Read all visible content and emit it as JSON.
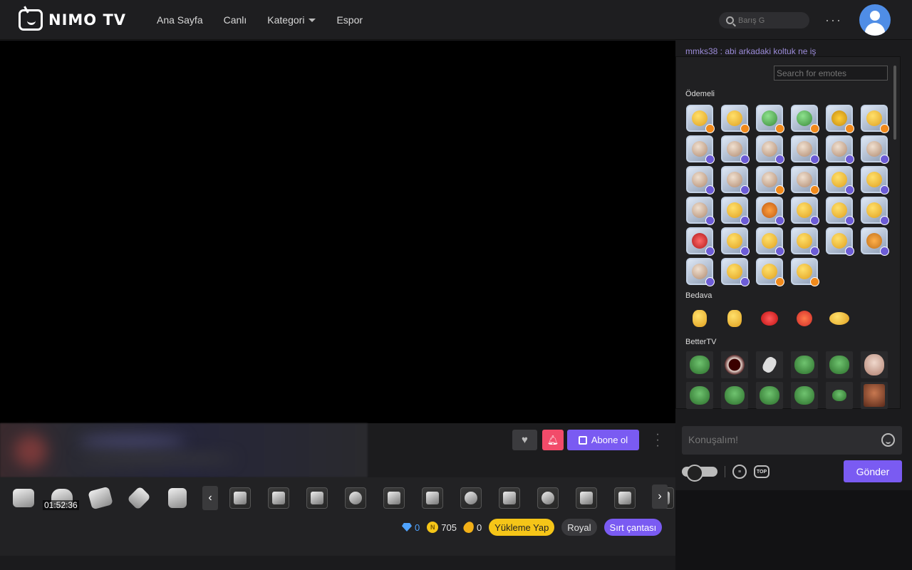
{
  "brand": {
    "logo_text": "NIMO TV"
  },
  "nav": {
    "items": [
      {
        "label": "Ana Sayfa"
      },
      {
        "label": "Canlı"
      },
      {
        "label": "Kategori"
      },
      {
        "label": "Espor"
      }
    ]
  },
  "search": {
    "placeholder": "Barış G"
  },
  "stream": {
    "subscribe_label": "Abone ol"
  },
  "gifts": {
    "timer": "01:52:36"
  },
  "wallet": {
    "diamonds": "0",
    "coins": "705",
    "beans": "0",
    "topup_label": "Yükleme Yap",
    "royal_label": "Royal",
    "backpack_label": "Sırt çantası"
  },
  "chat": {
    "peek_message": "mmks38 : abi arkadaki koltuk ne iş",
    "input_placeholder": "Konuşalım!",
    "send_label": "Gönder"
  },
  "emote_panel": {
    "search_placeholder": "Search for emotes",
    "sections": [
      {
        "title": "Ödemeli"
      },
      {
        "title": "Bedava"
      },
      {
        "title": "BetterTV"
      }
    ]
  },
  "colors": {
    "accent": "#7a5bf2",
    "bell": "#f24b6a",
    "topup": "#f5c518",
    "diamond": "#4fa3ff"
  }
}
